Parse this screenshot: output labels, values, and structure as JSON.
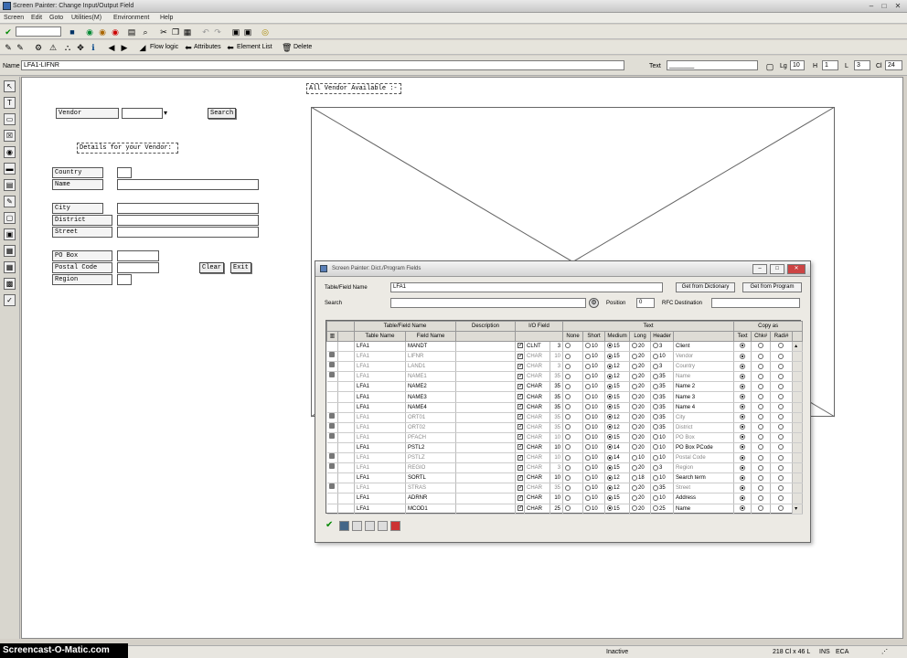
{
  "window": {
    "title": "Screen Painter: Change Input/Output Field",
    "min": "–",
    "max": "□",
    "close": "✕"
  },
  "menu": [
    "Screen",
    "Edit",
    "Goto",
    "Utilities(M)",
    "Environment",
    "Help"
  ],
  "toolbar2": {
    "flow_logic": "Flow logic",
    "attributes": "Attributes",
    "element_list": "Element List",
    "delete": "Delete"
  },
  "namebar": {
    "name_label": "Name",
    "name_value": "LFA1-LIFNR",
    "text_label": "Text",
    "text_value": "_______",
    "lg_label": "Lg",
    "lg_value": "10",
    "h_label": "H",
    "h_value": "1",
    "l_label": "L",
    "l_value": "3",
    "c_label": "Cl",
    "c_value": "24"
  },
  "canvas": {
    "all_vendor": "All Vendor Available :-",
    "vendor_label": "Vendor",
    "search_btn": "Search",
    "details": "Details for your Vendor:",
    "country": "Country",
    "name": "Name",
    "city": "City",
    "district": "District",
    "street": "Street",
    "po_box": "PO Box",
    "postal_code": "Postal Code",
    "region": "Region",
    "clear_btn": "Clear",
    "exit_btn": "Exit"
  },
  "dialog": {
    "title": "Screen Painter: Dict./Program Fields",
    "table_field_label": "Table/Field Name",
    "table_field_value": "LFA1",
    "get_dict": "Get from Dictionary",
    "get_prog": "Get from Program",
    "search_label": "Search",
    "position_label": "Position",
    "position_value": "0",
    "rfc_label": "RFC Destination",
    "headers1": [
      "Table/Field Name",
      "Description",
      "I/O Field",
      "Text",
      "Copy as"
    ],
    "headers2": [
      "Table Name",
      "Field Name",
      "None",
      "Short",
      "Medium",
      "Long",
      "Header",
      "Text",
      "Chk#",
      "Radi#"
    ],
    "rows": [
      {
        "lock": false,
        "tbl": "LFA1",
        "fld": "MANDT",
        "chk": true,
        "type": "CLNT",
        "len": "3",
        "s": "10",
        "m": "15",
        "l": "20",
        "h": "3",
        "txt": "Client",
        "sel": "m",
        "grey": false
      },
      {
        "lock": true,
        "tbl": "LFA1",
        "fld": "LIFNR",
        "chk": true,
        "type": "CHAR",
        "len": "10",
        "s": "10",
        "m": "15",
        "l": "20",
        "h": "10",
        "txt": "Vendor",
        "sel": "m",
        "grey": true
      },
      {
        "lock": true,
        "tbl": "LFA1",
        "fld": "LAND1",
        "chk": true,
        "type": "CHAR",
        "len": "3",
        "s": "10",
        "m": "12",
        "l": "20",
        "h": "3",
        "txt": "Country",
        "sel": "m",
        "grey": true
      },
      {
        "lock": true,
        "tbl": "LFA1",
        "fld": "NAME1",
        "chk": true,
        "type": "CHAR",
        "len": "35",
        "s": "10",
        "m": "12",
        "l": "20",
        "h": "35",
        "txt": "Name",
        "sel": "m",
        "grey": true
      },
      {
        "lock": false,
        "tbl": "LFA1",
        "fld": "NAME2",
        "chk": true,
        "type": "CHAR",
        "len": "35",
        "s": "10",
        "m": "15",
        "l": "20",
        "h": "35",
        "txt": "Name 2",
        "sel": "m",
        "grey": false
      },
      {
        "lock": false,
        "tbl": "LFA1",
        "fld": "NAME3",
        "chk": true,
        "type": "CHAR",
        "len": "35",
        "s": "10",
        "m": "15",
        "l": "20",
        "h": "35",
        "txt": "Name 3",
        "sel": "m",
        "grey": false
      },
      {
        "lock": false,
        "tbl": "LFA1",
        "fld": "NAME4",
        "chk": true,
        "type": "CHAR",
        "len": "35",
        "s": "10",
        "m": "15",
        "l": "20",
        "h": "35",
        "txt": "Name 4",
        "sel": "m",
        "grey": false
      },
      {
        "lock": true,
        "tbl": "LFA1",
        "fld": "ORT01",
        "chk": true,
        "type": "CHAR",
        "len": "35",
        "s": "10",
        "m": "12",
        "l": "20",
        "h": "35",
        "txt": "City",
        "sel": "m",
        "grey": true
      },
      {
        "lock": true,
        "tbl": "LFA1",
        "fld": "ORT02",
        "chk": true,
        "type": "CHAR",
        "len": "35",
        "s": "10",
        "m": "12",
        "l": "20",
        "h": "35",
        "txt": "District",
        "sel": "m",
        "grey": true
      },
      {
        "lock": true,
        "tbl": "LFA1",
        "fld": "PFACH",
        "chk": true,
        "type": "CHAR",
        "len": "10",
        "s": "10",
        "m": "15",
        "l": "20",
        "h": "10",
        "txt": "PO Box",
        "sel": "m",
        "grey": true
      },
      {
        "lock": false,
        "tbl": "LFA1",
        "fld": "PSTL2",
        "chk": true,
        "type": "CHAR",
        "len": "10",
        "s": "10",
        "m": "14",
        "l": "20",
        "h": "10",
        "txt": "PO Box PCode",
        "sel": "m",
        "grey": false
      },
      {
        "lock": true,
        "tbl": "LFA1",
        "fld": "PSTLZ",
        "chk": true,
        "type": "CHAR",
        "len": "10",
        "s": "10",
        "m": "14",
        "l": "10",
        "h": "10",
        "txt": "Postal Code",
        "sel": "m",
        "grey": true
      },
      {
        "lock": true,
        "tbl": "LFA1",
        "fld": "REGIO",
        "chk": true,
        "type": "CHAR",
        "len": "3",
        "s": "10",
        "m": "15",
        "l": "20",
        "h": "3",
        "txt": "Region",
        "sel": "m",
        "grey": true
      },
      {
        "lock": false,
        "tbl": "LFA1",
        "fld": "SORTL",
        "chk": true,
        "type": "CHAR",
        "len": "10",
        "s": "10",
        "m": "12",
        "l": "18",
        "h": "10",
        "txt": "Search term",
        "sel": "m",
        "grey": false
      },
      {
        "lock": true,
        "tbl": "LFA1",
        "fld": "STRAS",
        "chk": true,
        "type": "CHAR",
        "len": "35",
        "s": "10",
        "m": "12",
        "l": "20",
        "h": "35",
        "txt": "Street",
        "sel": "m",
        "grey": true
      },
      {
        "lock": false,
        "tbl": "LFA1",
        "fld": "ADRNR",
        "chk": true,
        "type": "CHAR",
        "len": "10",
        "s": "10",
        "m": "15",
        "l": "20",
        "h": "10",
        "txt": "Address",
        "sel": "m",
        "grey": false
      },
      {
        "lock": false,
        "tbl": "LFA1",
        "fld": "MCOD1",
        "chk": true,
        "type": "CHAR",
        "len": "25",
        "s": "10",
        "m": "15",
        "l": "20",
        "h": "25",
        "txt": "Name",
        "sel": "m",
        "grey": false
      }
    ]
  },
  "status": {
    "mode": "Inactive",
    "pos": "218 Cl x 46 L",
    "ins": "INS",
    "sys": "ECA"
  },
  "watermark": "Screencast-O-Matic.com"
}
